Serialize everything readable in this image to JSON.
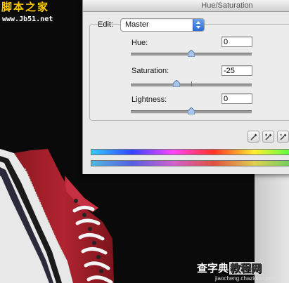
{
  "watermark_top": {
    "chinese": "脚本之家",
    "url": "www.Jb51.net"
  },
  "dialog": {
    "title": "Hue/Saturation",
    "edit": {
      "label": "Edit:",
      "value": "Master"
    },
    "hue": {
      "label": "Hue:",
      "value": "0",
      "slider_fraction": 0.5
    },
    "saturation": {
      "label": "Saturation:",
      "value": "-25",
      "slider_fraction": 0.375
    },
    "lightness": {
      "label": "Lightness:",
      "value": "0",
      "slider_fraction": 0.5
    },
    "tools": [
      "eyedropper-icon",
      "eyedropper-plus-icon",
      "eyedropper-minus-icon"
    ]
  },
  "colors": {
    "dialog_bg": "#e9e9e9",
    "select_accent": "#2e6bd6",
    "shoe_red": "#a41f2a",
    "spectrum_top": [
      "#33ccff",
      "#3344ff",
      "#ff44ff",
      "#ff3322",
      "#ffee33",
      "#44ff44"
    ],
    "spectrum_bottom": [
      "#4fb8e0",
      "#5560e0",
      "#d060d0",
      "#e05040",
      "#e0d050",
      "#60d060"
    ]
  },
  "watermark_bottom": {
    "part1": "查字典",
    "part2": "教程网",
    "url": "jiaocheng.chazidian.com"
  }
}
